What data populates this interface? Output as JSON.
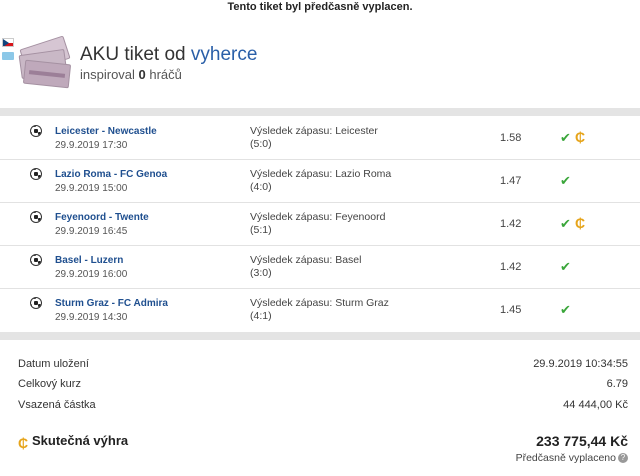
{
  "banner": "Tento tiket byl předčasně vyplacen.",
  "header": {
    "title_prefix": "AKU tiket od ",
    "username": "vyherce",
    "inspired_prefix": "inspiroval ",
    "inspired_count": "0",
    "inspired_suffix": " hráčů"
  },
  "matches": [
    {
      "teams": "Leicester - Newcastle",
      "date": "29.9.2019 17:30",
      "result_line": "Výsledek zápasu: Leicester",
      "score": "(5:0)",
      "odds": "1.58",
      "status": "✔",
      "cashout": "₵"
    },
    {
      "teams": "Lazio Roma - FC Genoa",
      "date": "29.9.2019 15:00",
      "result_line": "Výsledek zápasu: Lazio Roma",
      "score": "(4:0)",
      "odds": "1.47",
      "status": "✔",
      "cashout": ""
    },
    {
      "teams": "Feyenoord - Twente",
      "date": "29.9.2019 16:45",
      "result_line": "Výsledek zápasu: Feyenoord",
      "score": "(5:1)",
      "odds": "1.42",
      "status": "✔",
      "cashout": "₵"
    },
    {
      "teams": "Basel - Luzern",
      "date": "29.9.2019 16:00",
      "result_line": "Výsledek zápasu: Basel",
      "score": "(3:0)",
      "odds": "1.42",
      "status": "✔",
      "cashout": ""
    },
    {
      "teams": "Sturm Graz - FC Admira",
      "date": "29.9.2019 14:30",
      "result_line": "Výsledek zápasu: Sturm Graz",
      "score": "(4:1)",
      "odds": "1.45",
      "status": "✔",
      "cashout": ""
    }
  ],
  "summary": {
    "saved_label": "Datum uložení",
    "saved_value": "29.9.2019 10:34:55",
    "total_odds_label": "Celkový kurz",
    "total_odds_value": "6.79",
    "stake_label": "Vsazená částka",
    "stake_value": "44 444,00 Kč",
    "win_label": "Skutečná výhra",
    "win_value": "233 775,44 Kč",
    "win_icon": "₵",
    "early_label": "Předčasně vyplaceno",
    "help_icon": "?"
  },
  "colors": {
    "accent_link": "#2a5fa8",
    "check_green": "#3aa63a",
    "coin_gold": "#e6a41a"
  }
}
